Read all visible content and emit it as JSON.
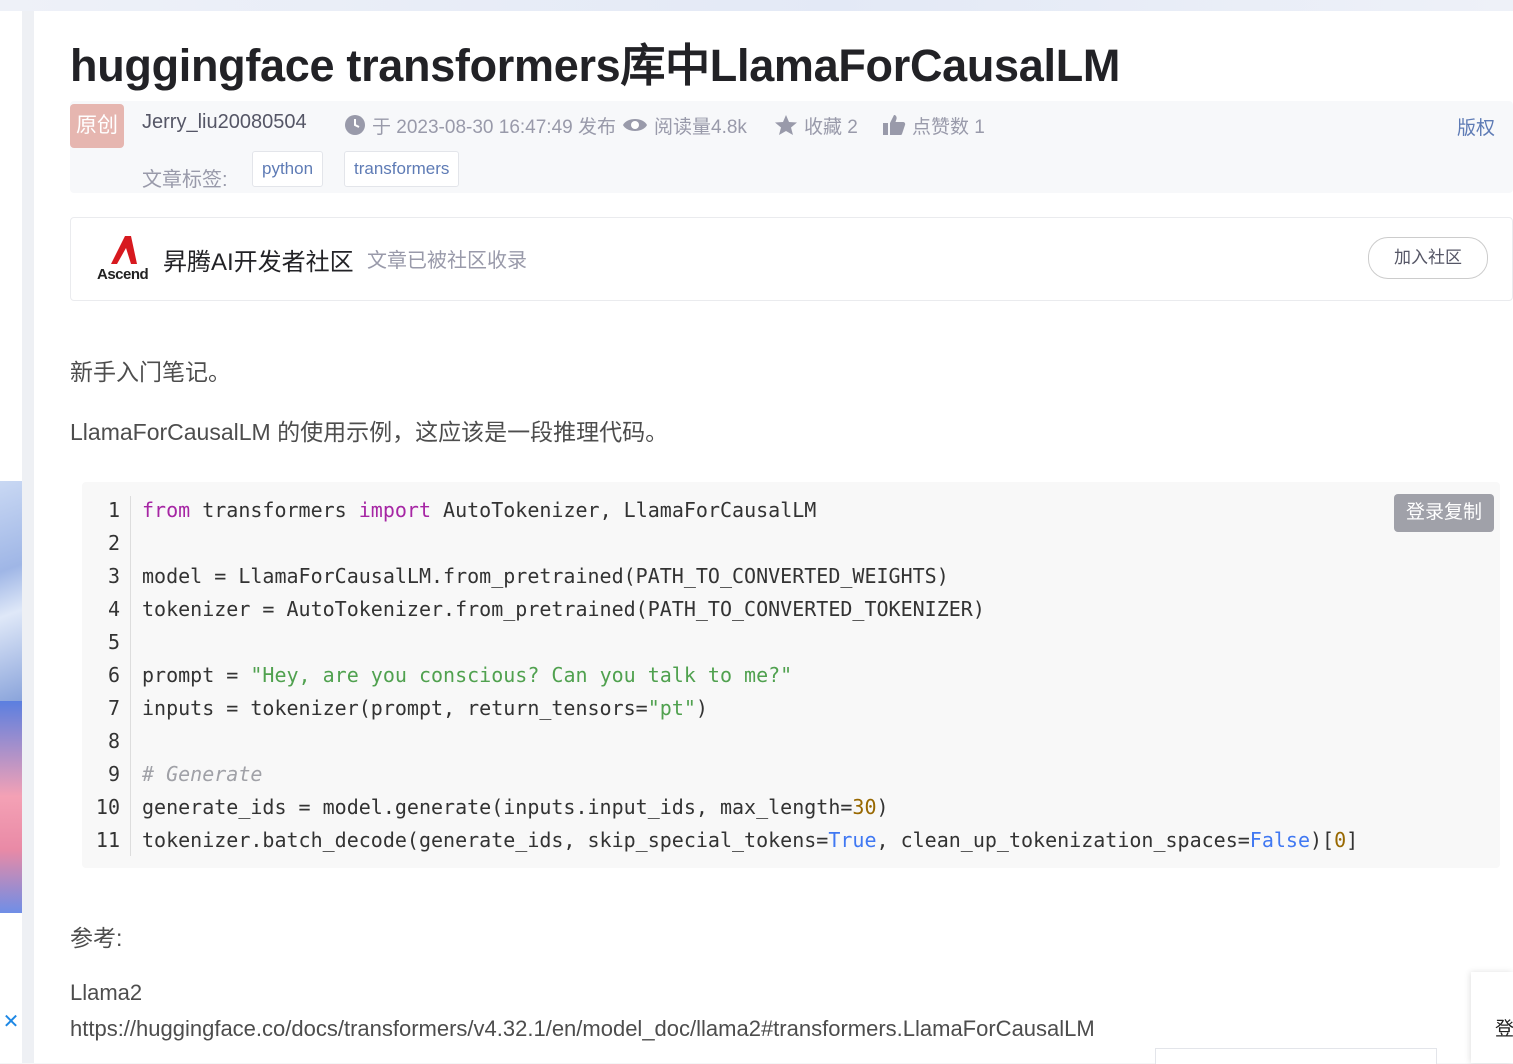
{
  "article": {
    "title": "huggingface transformers库中LlamaForCausalLM",
    "badge": "原创",
    "author": "Jerry_liu20080504",
    "publish": "于 2023-08-30 16:47:49 发布",
    "reads": "阅读量4.8k",
    "favorites": "收藏 2",
    "likes": "点赞数 1",
    "copyright": "版权",
    "tags_label": "文章标签:",
    "tags": [
      "python",
      "transformers"
    ]
  },
  "community": {
    "logo_text": "Ascend",
    "name": "昇腾AI开发者社区",
    "sub": "文章已被社区收录",
    "join": "加入社区"
  },
  "body": {
    "p1": "新手入门笔记。",
    "p2": "LlamaForCausalLM 的使用示例，这应该是一段推理代码。",
    "ref_label": "参考:",
    "ref_title": "Llama2",
    "ref_url": "https://huggingface.co/docs/transformers/v4.32.1/en/model_doc/llama2#transformers.LlamaForCausalLM"
  },
  "code": {
    "copy_button": "登录复制",
    "lines": [
      [
        {
          "t": "from",
          "c": "kw"
        },
        {
          "t": " transformers "
        },
        {
          "t": "import",
          "c": "kw"
        },
        {
          "t": " AutoTokenizer, LlamaForCausalLM"
        }
      ],
      [],
      [
        {
          "t": "model = LlamaForCausalLM.from_pretrained(PATH_TO_CONVERTED_WEIGHTS)"
        }
      ],
      [
        {
          "t": "tokenizer = AutoTokenizer.from_pretrained(PATH_TO_CONVERTED_TOKENIZER)"
        }
      ],
      [],
      [
        {
          "t": "prompt = "
        },
        {
          "t": "\"Hey, are you conscious? Can you talk to me?\"",
          "c": "str"
        }
      ],
      [
        {
          "t": "inputs = tokenizer(prompt, return_tensors="
        },
        {
          "t": "\"pt\"",
          "c": "str"
        },
        {
          "t": ")"
        }
      ],
      [],
      [
        {
          "t": "# Generate",
          "c": "cm"
        }
      ],
      [
        {
          "t": "generate_ids = model.generate(inputs.input_ids, max_length="
        },
        {
          "t": "30",
          "c": "num"
        },
        {
          "t": ")"
        }
      ],
      [
        {
          "t": "tokenizer.batch_decode(generate_ids, skip_special_tokens="
        },
        {
          "t": "True",
          "c": "lit"
        },
        {
          "t": ", clean_up_tokenization_spaces="
        },
        {
          "t": "False",
          "c": "lit"
        },
        {
          "t": ")["
        },
        {
          "t": "0",
          "c": "num"
        },
        {
          "t": "]"
        }
      ]
    ]
  },
  "sidebar": {
    "ad_close": "✕",
    "login_char": "登"
  },
  "icons": {
    "clock": "clock-icon",
    "eye": "eye-icon",
    "star": "star-icon",
    "thumb": "thumbs-up-icon"
  },
  "colors": {
    "badge_bg": "#e6b6b0",
    "tag_text": "#5e7bb5",
    "copy_button_bg": "#a0a1a9"
  }
}
